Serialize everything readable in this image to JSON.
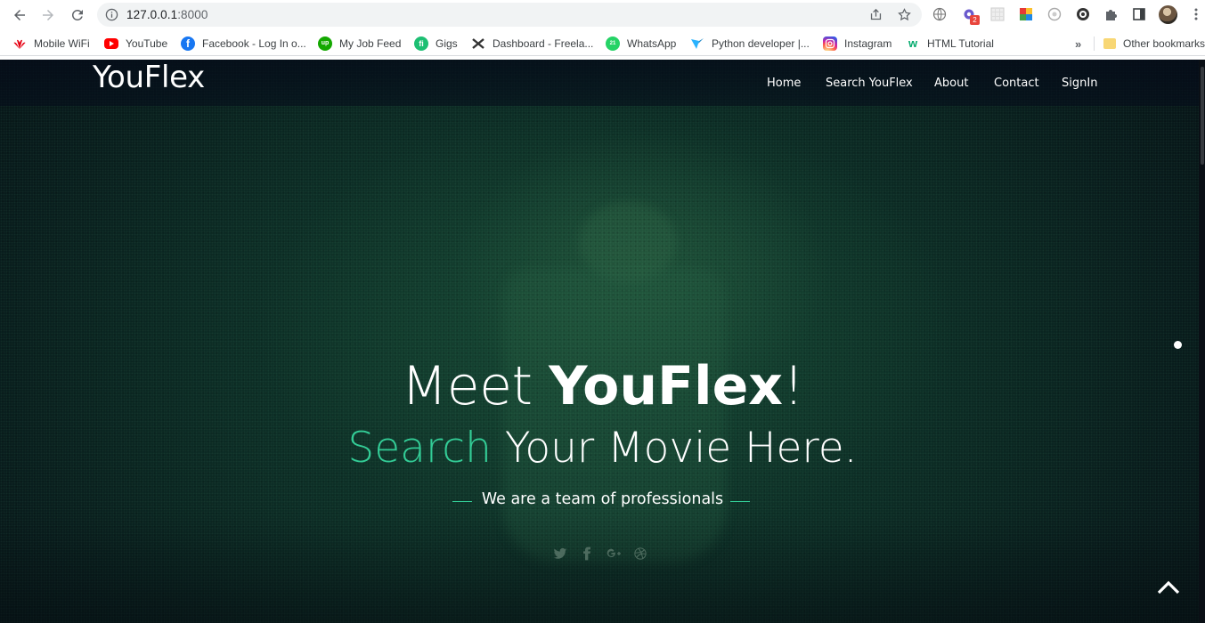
{
  "browser": {
    "url_host": "127.0.0.1",
    "url_rest": ":8000",
    "extension_badge": "2"
  },
  "bookmarks": [
    {
      "label": "Mobile WiFi",
      "icon": "huawei-icon",
      "color": "#e60012"
    },
    {
      "label": "YouTube",
      "icon": "youtube-icon",
      "color": "#ff0000"
    },
    {
      "label": "Facebook - Log In o...",
      "icon": "facebook-icon",
      "color": "#1877f2"
    },
    {
      "label": "My Job Feed",
      "icon": "upwork-icon",
      "color": "#14a800"
    },
    {
      "label": "Gigs",
      "icon": "fiverr-icon",
      "color": "#1dbf73"
    },
    {
      "label": "Dashboard - Freela...",
      "icon": "freelancer-icon",
      "color": "#29b2fe"
    },
    {
      "label": "WhatsApp",
      "icon": "whatsapp-icon",
      "color": "#25d366"
    },
    {
      "label": "Python developer |...",
      "icon": "python-job-icon",
      "color": "#29b2fe"
    },
    {
      "label": "Instagram",
      "icon": "instagram-icon",
      "color": "#e1306c"
    },
    {
      "label": "HTML Tutorial",
      "icon": "w3schools-icon",
      "color": "#04aa6d"
    }
  ],
  "other_bookmarks": "Other bookmarks",
  "site": {
    "brand": "YouFlex",
    "menu": [
      "Home",
      "Search YouFlex",
      "About",
      "Contact",
      "SignIn"
    ]
  },
  "hero": {
    "title_prefix": "Meet ",
    "title_brand": "YouFlex",
    "title_suffix": "!",
    "subtitle_accent": "Search",
    "subtitle_rest": " Your Movie Here.",
    "tagline": "We are a team of professionals"
  },
  "social_icons": [
    "twitter-icon",
    "facebook-icon",
    "google-plus-icon",
    "dribbble-icon"
  ],
  "colors": {
    "accent": "#33cc96",
    "hero_bg": "#0b2b24"
  }
}
